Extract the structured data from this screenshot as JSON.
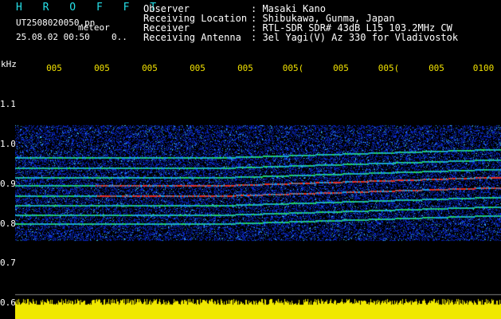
{
  "header": {
    "title": "H R O F F T",
    "filename": "UT2508020050.pn",
    "tag": "meteor",
    "datetime": "25.08.02 00:50",
    "count": "0.."
  },
  "info": [
    {
      "key": "Observer",
      "value": ": Masaki Kano"
    },
    {
      "key": "Receiving Location",
      "value": ": Shibukawa, Gunma, Japan"
    },
    {
      "key": "Receiver",
      "value": ": RTL-SDR SDR# 43dB L15 103.2MHz CW"
    },
    {
      "key": "Receiving Antenna",
      "value": ": 3el Yagi(V) Az 330 for Vladivostok"
    }
  ],
  "plot": {
    "y_unit": "kHz",
    "time_ticks": [
      "005",
      "005",
      "005",
      "005",
      "005",
      "005(",
      "005",
      "005(",
      "005",
      "0100"
    ],
    "freq_ticks": [
      "1.1",
      "1.0",
      "0.9",
      "0.8",
      "0.7",
      "0.6"
    ],
    "colors": {
      "bg": "#000000",
      "noise": "#0a28c8",
      "mid": "#20d060",
      "hot": "#e83020",
      "floor": "#f0e800"
    }
  }
}
